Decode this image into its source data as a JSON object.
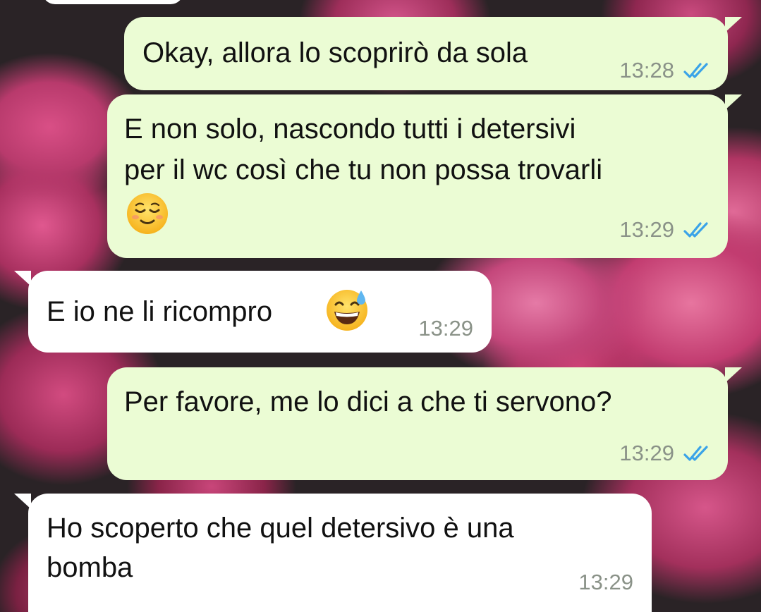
{
  "colors": {
    "outgoing_bubble": "#ebfcd4",
    "incoming_bubble": "#ffffff",
    "read_ticks": "#3aa3e8",
    "timestamp": "#8a9288"
  },
  "messages": [
    {
      "direction": "outgoing",
      "text": "Okay, allora lo scoprirò da sola",
      "time": "13:28",
      "status": "read"
    },
    {
      "direction": "outgoing",
      "text_line1": "E non solo, nascondo tutti i detersivi",
      "text_line2": "per il wc così che tu non possa trovarli",
      "emoji": "relieved-face-emoji",
      "time": "13:29",
      "status": "read"
    },
    {
      "direction": "incoming",
      "text": "E io ne li ricompro",
      "emoji": "grinning-face-with-sweat-emoji",
      "time": "13:29"
    },
    {
      "direction": "outgoing",
      "text": "Per favore, me lo dici a che ti servono?",
      "time": "13:29",
      "status": "read"
    },
    {
      "direction": "incoming",
      "text_line1": "Ho scoperto che quel detersivo è una",
      "text_line2": "bomba",
      "time": "13:29"
    }
  ]
}
